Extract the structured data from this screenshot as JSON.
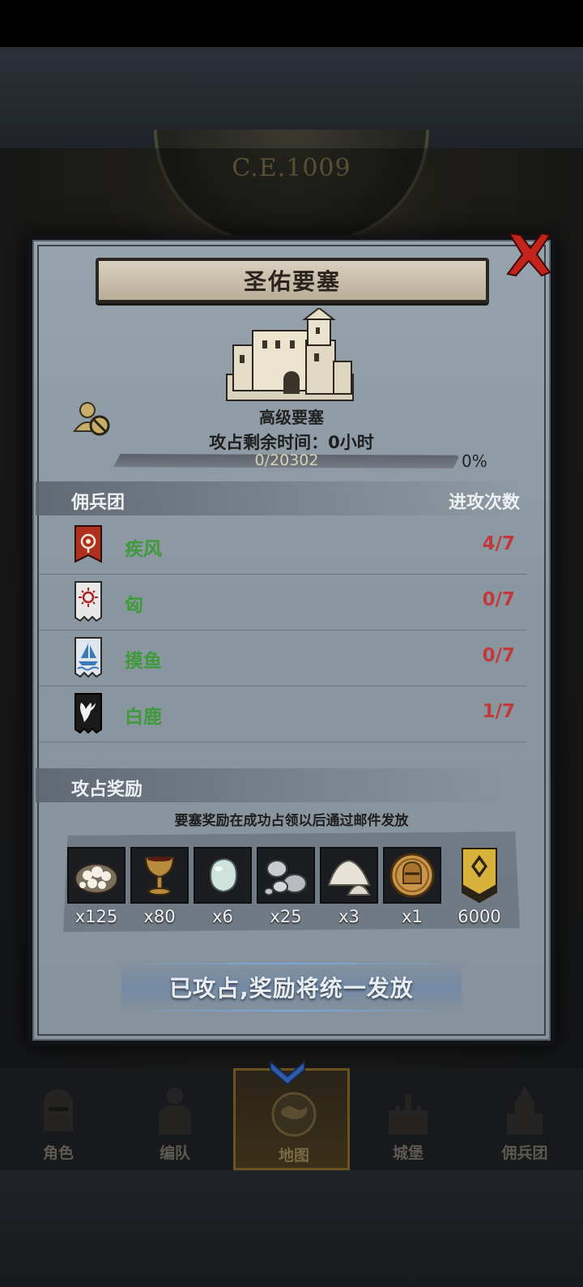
{
  "background": {
    "era": "C.E.1009"
  },
  "dialog": {
    "title": "圣佑要塞",
    "fortress_level": "高级要塞",
    "time_remaining": "攻占剩余时间：0小时",
    "progress": {
      "label": "0/20302",
      "current": 0,
      "total": 20302,
      "percent_label": "0%"
    },
    "mercenary_section": {
      "title": "佣兵团",
      "attacks_header": "进攻次数",
      "rows": [
        {
          "name": "疾风",
          "count": "4/7",
          "banner_icon": "eye-sigil-banner-icon",
          "banner_color": "#b03020"
        },
        {
          "name": "匈",
          "count": "0/7",
          "banner_icon": "sun-sigil-banner-icon",
          "banner_color": "#e8e8e8"
        },
        {
          "name": "摸鱼",
          "count": "0/7",
          "banner_icon": "ship-sigil-banner-icon",
          "banner_color": "#dfe6ee"
        },
        {
          "name": "白鹿",
          "count": "1/7",
          "banner_icon": "stag-sigil-banner-icon",
          "banner_color": "#1a1a1a"
        }
      ]
    },
    "reward_section": {
      "title": "攻占奖励",
      "note": "要塞奖励在成功占领以后通过邮件发放",
      "items": [
        {
          "icon": "cotton-bundle-icon",
          "qty": "x125"
        },
        {
          "icon": "goblet-icon",
          "qty": "x80"
        },
        {
          "icon": "pearl-gem-icon",
          "qty": "x6"
        },
        {
          "icon": "silver-ore-icon",
          "qty": "x25"
        },
        {
          "icon": "salt-pile-icon",
          "qty": "x3"
        },
        {
          "icon": "knight-coin-icon",
          "qty": "x1"
        },
        {
          "icon": "honor-banner-icon",
          "qty": "6000"
        }
      ]
    },
    "claim_status": "已攻占,奖励将统一发放"
  },
  "bottom_nav": {
    "items": [
      {
        "label": "角色",
        "icon": "knight-helmet-icon"
      },
      {
        "label": "编队",
        "icon": "armored-knight-icon"
      },
      {
        "label": "地图",
        "icon": "world-map-icon",
        "active": true
      },
      {
        "label": "城堡",
        "icon": "castle-icon"
      },
      {
        "label": "佣兵团",
        "icon": "mercenary-castle-icon"
      }
    ]
  },
  "colors": {
    "name_green": "#3e9a3a",
    "count_red": "#c03a3a",
    "panel_blue_gray": "#8e9aa4"
  }
}
